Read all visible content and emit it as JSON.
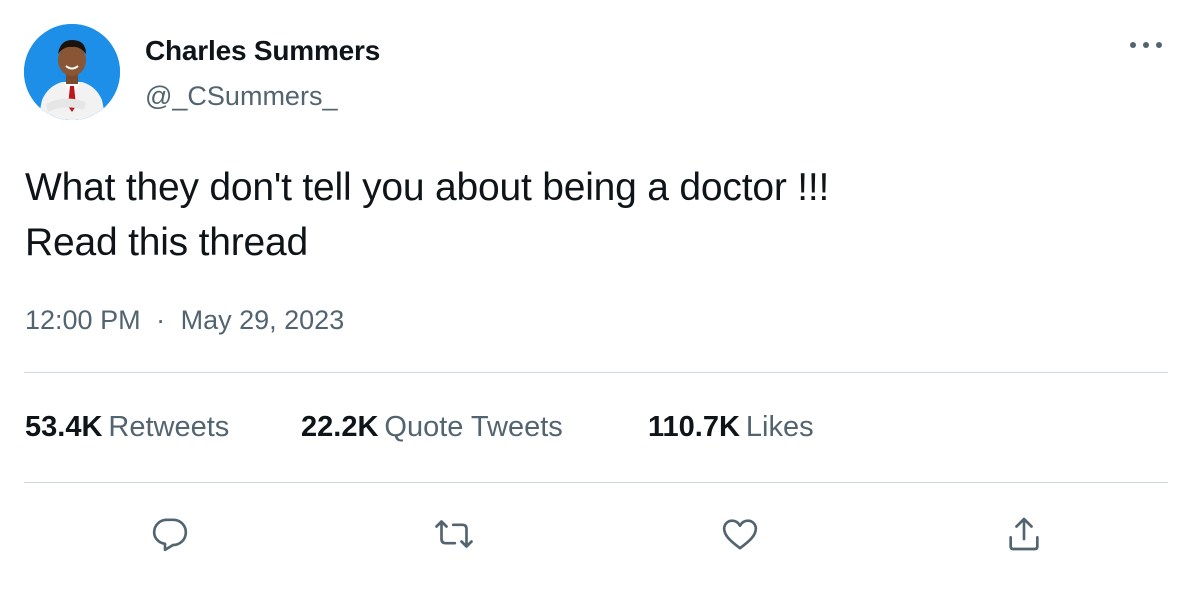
{
  "user": {
    "display_name": "Charles Summers",
    "handle": "@_CSummers_",
    "avatar_bg_color": "#1d8fe8"
  },
  "tweet": {
    "lines": [
      "What they don't tell you about being a doctor !!!",
      "Read this thread"
    ],
    "time": "12:00 PM",
    "separator": "·",
    "date": "May 29, 2023"
  },
  "stats": {
    "retweets": {
      "count": "53.4K",
      "label": "Retweets"
    },
    "quote_tweets": {
      "count": "22.2K",
      "label": "Quote Tweets"
    },
    "likes": {
      "count": "110.7K",
      "label": "Likes"
    }
  },
  "actions": [
    {
      "icon": "reply-icon"
    },
    {
      "icon": "retweet-icon"
    },
    {
      "icon": "like-icon"
    },
    {
      "icon": "share-icon"
    }
  ],
  "colors": {
    "text_primary": "#0f1419",
    "text_secondary": "#536471",
    "divider": "#cfd9de",
    "icon": "#536471"
  }
}
